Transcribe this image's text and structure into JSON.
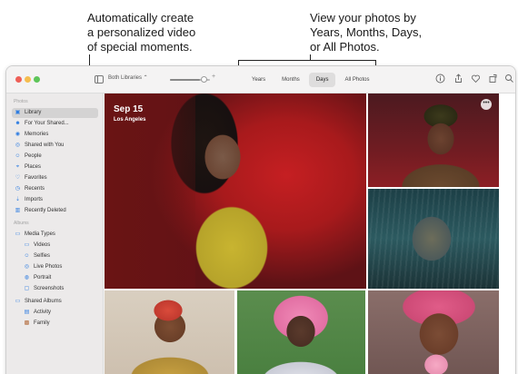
{
  "callouts": {
    "left_line1": "Automatically create",
    "left_line2": "a personalized video",
    "left_line3": "of special moments.",
    "right_line1": "View your photos by",
    "right_line2": "Years, Months, Days,",
    "right_line3": "or All Photos."
  },
  "toolbar": {
    "library_select": "Both Libraries ⌃",
    "view_tabs": [
      "Years",
      "Months",
      "Days",
      "All Photos"
    ],
    "active_tab": "Days",
    "zoom_level": 0.75,
    "icons": [
      "info-icon",
      "share-icon",
      "heart-icon",
      "rotate-icon",
      "search-icon"
    ]
  },
  "sidebar": {
    "section_photos": "Photos",
    "items": [
      {
        "label": "Library",
        "icon": "library-icon"
      },
      {
        "label": "For Your Shared...",
        "icon": "people-icon"
      },
      {
        "label": "Memories",
        "icon": "memories-icon"
      },
      {
        "label": "Shared with You",
        "icon": "shared-icon"
      },
      {
        "label": "People",
        "icon": "person-icon"
      },
      {
        "label": "Places",
        "icon": "pin-icon"
      },
      {
        "label": "Favorites",
        "icon": "heart-icon"
      },
      {
        "label": "Recents",
        "icon": "clock-icon"
      },
      {
        "label": "Imports",
        "icon": "import-icon"
      },
      {
        "label": "Recently Deleted",
        "icon": "trash-icon"
      }
    ],
    "section_albums": "Albums",
    "media_types": {
      "label": "Media Types",
      "items": [
        "Videos",
        "Selfies",
        "Live Photos",
        "Portrait",
        "Screenshots"
      ]
    },
    "shared_albums": {
      "label": "Shared Albums",
      "items": [
        "Activity",
        "Family"
      ]
    }
  },
  "hero": {
    "date": "Sep 15",
    "location": "Los Angeles"
  },
  "more_button": "•••"
}
